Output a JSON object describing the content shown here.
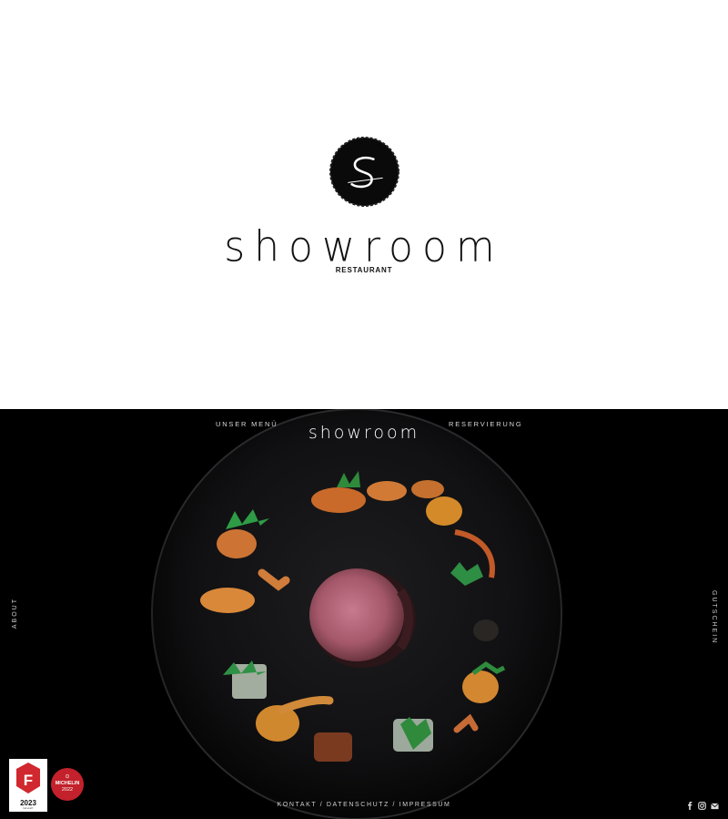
{
  "intro": {
    "logo_letter": "S",
    "wordmark": "showroom",
    "subtitle": "RESTAURANT"
  },
  "hero": {
    "nav": {
      "menu_label": "UNSER MENÜ",
      "brand": "showroom",
      "reservation_label": "RESERVIERUNG"
    },
    "side": {
      "left_label": "ABOUT",
      "right_label": "GUTSCHEIN"
    },
    "footer": {
      "links": [
        "KONTAKT",
        "DATENSCHUTZ",
        "IMPRESSUM"
      ],
      "separator": " / "
    },
    "social_icons": [
      "facebook-icon",
      "instagram-icon",
      "email-icon"
    ],
    "badges": {
      "falstaff": {
        "letter": "F",
        "year": "2023",
        "caption": "falstaff"
      },
      "michelin": {
        "top": "⊙",
        "name": "MICHELIN",
        "year": "2022"
      }
    }
  },
  "colors": {
    "background_top": "#ffffff",
    "background_hero": "#000000",
    "text_dark": "#111111",
    "text_light": "#d8d8d8",
    "michelin_red": "#c3212b",
    "falstaff_red": "#d0282e"
  }
}
